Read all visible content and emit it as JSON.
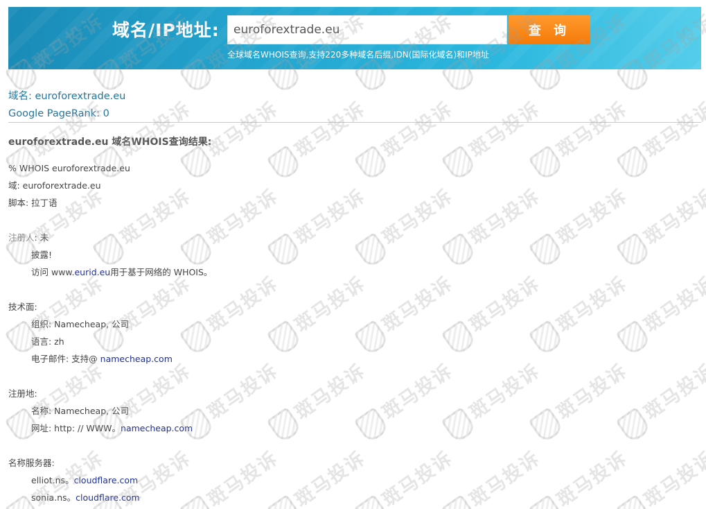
{
  "banner": {
    "label": "域名/IP地址:",
    "search_value": "euroforextrade.eu",
    "button_label": "查 询",
    "subtitle": "全球域名WHOIS查询,支持220多种域名后缀,IDN(国际化域名)和IP地址"
  },
  "info": {
    "domain_line": "域名: euroforextrade.eu",
    "pagerank_line": "Google PageRank: 0"
  },
  "result_title": "euroforextrade.eu 域名WHOIS查询结果:",
  "whois": {
    "header": "% WHOIS euroforextrade.eu",
    "domain": "域: euroforextrade.eu",
    "script": "脚本: 拉丁语",
    "registrant_label": "注册人",
    "registrant_value": ": 未",
    "registrant_disclose": "披露!",
    "visit_prefix": "访问 www.",
    "visit_link": "eurid.eu",
    "visit_suffix": "用于基于网络的 WHOIS。",
    "technical_label": "技术面:",
    "tech_org": "组织: Namecheap, 公司",
    "tech_lang": "语言: zh",
    "tech_email_prefix": "电子邮件: 支持@ ",
    "tech_email_link": "namecheap.com",
    "registrar_label": "注册地:",
    "registrar_name": "名称: Namecheap, 公司",
    "registrar_url_prefix": "网址: http: // WWW。",
    "registrar_url_link": "namecheap.com",
    "ns_label": "名称服务器:",
    "ns1_prefix": "elliot.ns。",
    "ns1_link": "cloudflare.com",
    "ns2_prefix": "sonia.ns。",
    "ns2_link": "cloudflare.com"
  },
  "watermark": {
    "text": "斑马投诉"
  }
}
